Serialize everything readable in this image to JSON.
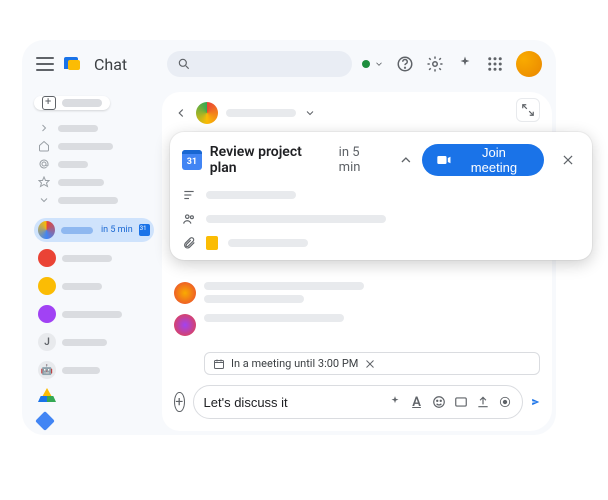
{
  "header": {
    "app_name": "Chat"
  },
  "sidebar": {
    "active_badge": "in 5 min"
  },
  "meeting_card": {
    "calendar_day": "31",
    "title": "Review project plan",
    "time_label": "in 5 min",
    "join_label": "Join meeting"
  },
  "status_chip": {
    "text": "In a meeting until 3:00 PM"
  },
  "compose": {
    "value": "Let's discuss it",
    "placeholder": ""
  }
}
